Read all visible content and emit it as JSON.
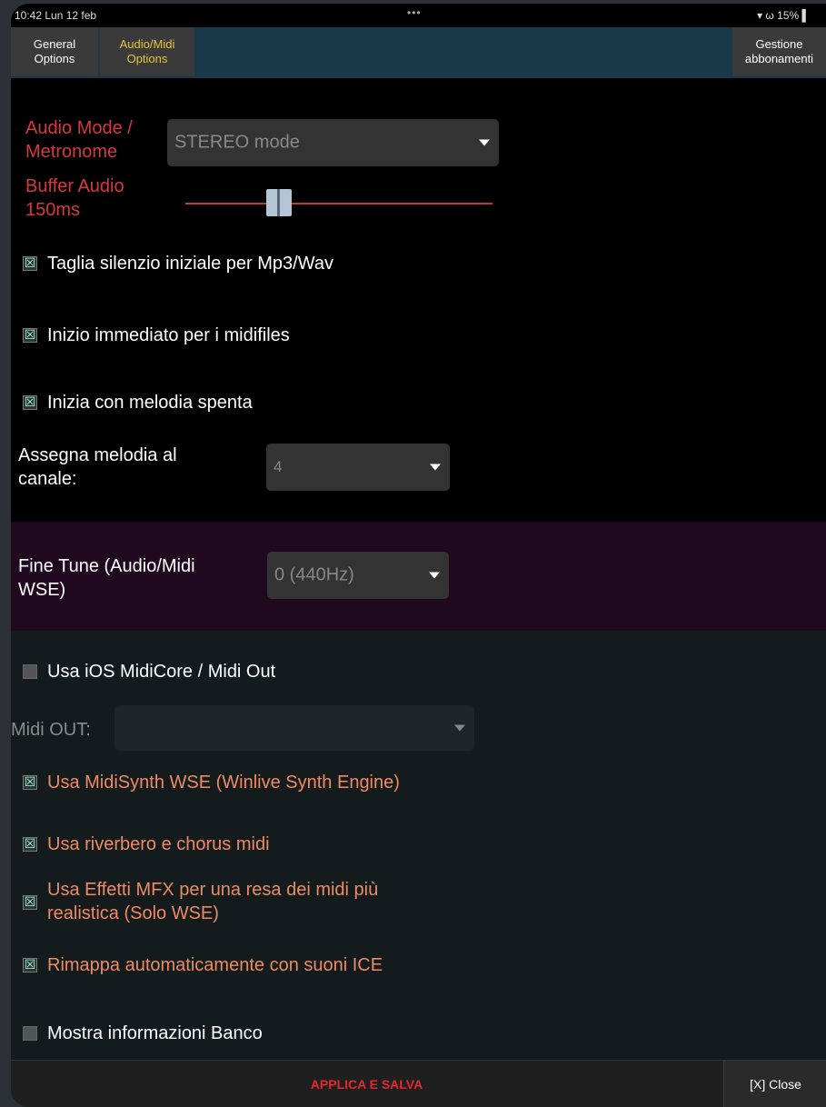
{
  "status_bar": {
    "time_date": "10:42  Lun 12 feb",
    "dots": "•••",
    "right": "▾ ω 15% ▌"
  },
  "tabs": [
    {
      "line1": "General",
      "line2": "Options"
    },
    {
      "line1": "Audio/Midi",
      "line2": "Options"
    },
    {
      "line1": "Gestione",
      "line2": "abbonamenti"
    }
  ],
  "settings": {
    "audio_mode": {
      "label_line1": "Audio Mode /",
      "label_line2": "Metronome",
      "value": "STEREO mode"
    },
    "buffer_audio": {
      "label_line1": "Buffer Audio",
      "label_line2": "150ms",
      "level_fraction": 0.3
    },
    "checkbox_taglia": {
      "label": "Taglia silenzio iniziale per Mp3/Wav",
      "checked": true
    },
    "checkbox_inizio_immediato": {
      "label": "Inizio immediato per i midifiles",
      "checked": true
    },
    "checkbox_melodia_spenta": {
      "label": "Inizia con melodia spenta",
      "checked": true
    },
    "assegna_melodia": {
      "label_line1": "Assegna melodia al",
      "label_line2": "canale:",
      "value": "4"
    },
    "fine_tune": {
      "label_line1": "Fine Tune (Audio/Midi",
      "label_line2": "WSE)",
      "value": "0 (440Hz)"
    },
    "checkbox_midicore": {
      "label": "Usa iOS MidiCore / Midi Out",
      "checked": false
    },
    "midi_out": {
      "label": "Midi OUT:",
      "value": ""
    },
    "checkbox_midisynth": {
      "label": "Usa MidiSynth WSE (Winlive Synth Engine)",
      "checked": true
    },
    "checkbox_riverbero": {
      "label": "Usa riverbero e chorus midi",
      "checked": true
    },
    "checkbox_mfx": {
      "label_line1": "Usa Effetti MFX per una resa dei midi più",
      "label_line2": "realistica (Solo WSE)",
      "checked": true
    },
    "checkbox_rimappa": {
      "label": "Rimappa automaticamente con suoni ICE",
      "checked": true
    },
    "checkbox_mostra_banco": {
      "label": "Mostra informazioni Banco",
      "checked": false
    }
  },
  "check_mark": "☒",
  "bottom": {
    "applica": "APPLICA E SALVA",
    "close": "[X] Close"
  },
  "colors": {
    "accent_red": "#d8373d",
    "orange_label": "#ef8a62",
    "tab_active": "#e8c43a",
    "fine_tune_band": "#20081e"
  }
}
